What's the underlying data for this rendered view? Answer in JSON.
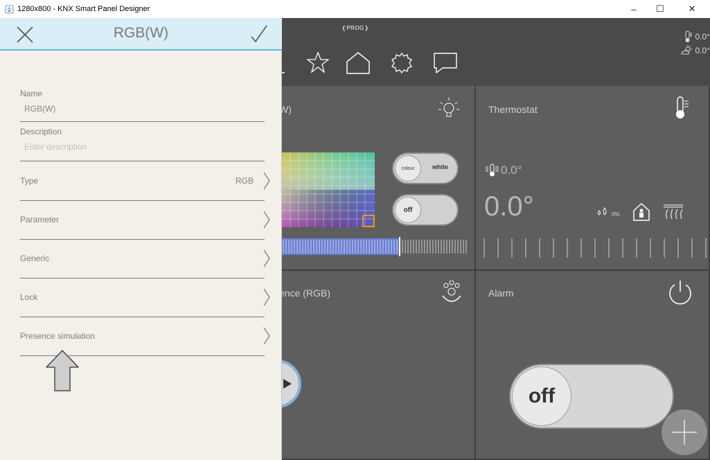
{
  "window": {
    "title": "1280x800 - KNX Smart Panel Designer",
    "minimize": "–",
    "maximize": "☐",
    "close": "✕"
  },
  "topbar": {
    "prog": "❬PROG❭",
    "weather": {
      "indoor": "0.0°",
      "outdoor": "0.0°"
    }
  },
  "tiles": {
    "rgb": {
      "title_partial": "W)",
      "toggle1": {
        "knob": "colour",
        "label": "white"
      },
      "toggle2": {
        "knob": "off"
      }
    },
    "thermostat": {
      "title": "Thermostat",
      "setpoint": "0.0°",
      "actual": "0.0°",
      "humidity": "0%"
    },
    "presence": {
      "title_partial": "ence (RGB)"
    },
    "alarm": {
      "title": "Alarm",
      "toggle": {
        "knob": "off"
      }
    }
  },
  "panel": {
    "title": "RGB(W)",
    "name": {
      "label": "Name",
      "value": "RGB(W)"
    },
    "description": {
      "label": "Description",
      "placeholder": "Enter description"
    },
    "rows": [
      {
        "label": "Type",
        "value": "RGB"
      },
      {
        "label": "Parameter",
        "value": ""
      },
      {
        "label": "Generic",
        "value": ""
      },
      {
        "label": "Lock",
        "value": ""
      },
      {
        "label": "Presence simulation",
        "value": ""
      }
    ]
  },
  "colors": {
    "panel_bg": "#f3efe9",
    "header_bg": "#d9eef7",
    "accent": "#5db5d9",
    "tile_bg": "#5e5e5e",
    "slider_fill": "#6a7fd0"
  }
}
